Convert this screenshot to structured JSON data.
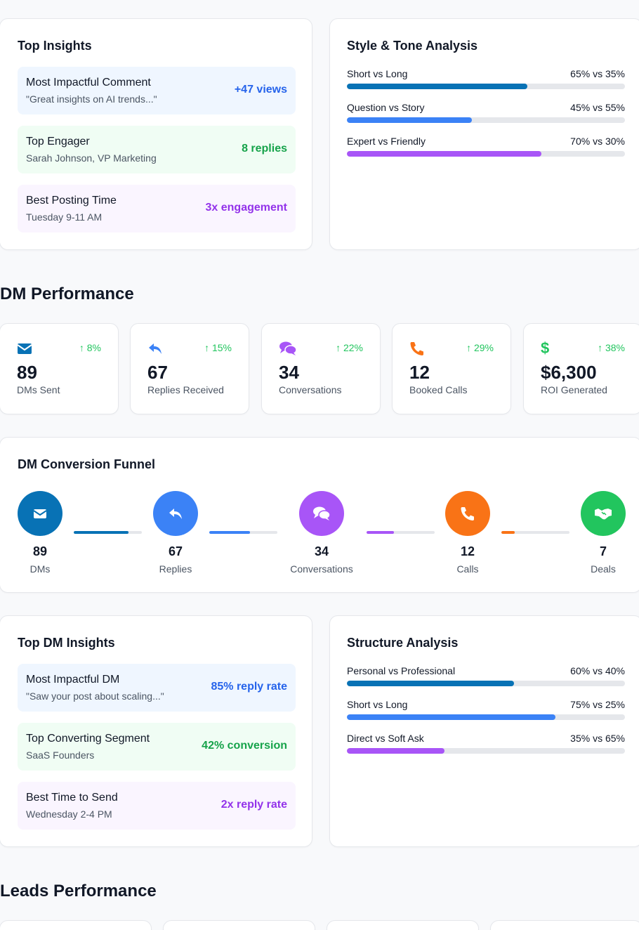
{
  "top_insights": {
    "title": "Top Insights",
    "items": [
      {
        "title": "Most Impactful Comment",
        "sub": "\"Great insights on AI trends...\"",
        "metric": "+47 views"
      },
      {
        "title": "Top Engager",
        "sub": "Sarah Johnson, VP Marketing",
        "metric": "8 replies"
      },
      {
        "title": "Best Posting Time",
        "sub": "Tuesday 9-11 AM",
        "metric": "3x engagement"
      }
    ]
  },
  "style_tone": {
    "title": "Style & Tone Analysis",
    "rows": [
      {
        "label": "Short vs Long",
        "value": "65% vs 35%",
        "percent": 65,
        "color": "#0872b5"
      },
      {
        "label": "Question vs Story",
        "value": "45% vs 55%",
        "percent": 45,
        "color": "#3b82f6"
      },
      {
        "label": "Expert vs Friendly",
        "value": "70% vs 30%",
        "percent": 70,
        "color": "#a855f7"
      }
    ]
  },
  "dm_performance": {
    "title": "DM Performance",
    "stats": [
      {
        "icon": "envelope-icon",
        "change": "8%",
        "value": "89",
        "label": "DMs Sent",
        "color": "#0872b5"
      },
      {
        "icon": "reply-icon",
        "change": "15%",
        "value": "67",
        "label": "Replies Received",
        "color": "#3b82f6"
      },
      {
        "icon": "comments-icon",
        "change": "22%",
        "value": "34",
        "label": "Conversations",
        "color": "#a855f7"
      },
      {
        "icon": "phone-icon",
        "change": "29%",
        "value": "12",
        "label": "Booked Calls",
        "color": "#f97316"
      },
      {
        "icon": "dollar-icon",
        "change": "38%",
        "value": "$6,300",
        "label": "ROI Generated",
        "color": "#22c55e"
      }
    ]
  },
  "funnel": {
    "title": "DM Conversion Funnel",
    "steps": [
      {
        "icon": "envelope-icon",
        "value": "89",
        "label": "DMs",
        "color": "#0872b5"
      },
      {
        "icon": "reply-icon",
        "value": "67",
        "label": "Replies",
        "color": "#3b82f6"
      },
      {
        "icon": "comments-icon",
        "value": "34",
        "label": "Conversations",
        "color": "#a855f7"
      },
      {
        "icon": "phone-icon",
        "value": "12",
        "label": "Calls",
        "color": "#f97316"
      },
      {
        "icon": "handshake-icon",
        "value": "7",
        "label": "Deals",
        "color": "#22c55e"
      }
    ],
    "connectors": [
      {
        "percent": 80,
        "color": "#0872b5"
      },
      {
        "percent": 60,
        "color": "#3b82f6"
      },
      {
        "percent": 40,
        "color": "#a855f7"
      },
      {
        "percent": 20,
        "color": "#f97316"
      }
    ]
  },
  "top_dm_insights": {
    "title": "Top DM Insights",
    "items": [
      {
        "title": "Most Impactful DM",
        "sub": "\"Saw your post about scaling...\"",
        "metric": "85% reply rate"
      },
      {
        "title": "Top Converting Segment",
        "sub": "SaaS Founders",
        "metric": "42% conversion"
      },
      {
        "title": "Best Time to Send",
        "sub": "Wednesday 2-4 PM",
        "metric": "2x reply rate"
      }
    ]
  },
  "structure": {
    "title": "Structure Analysis",
    "rows": [
      {
        "label": "Personal vs Professional",
        "value": "60% vs 40%",
        "percent": 60,
        "color": "#0872b5"
      },
      {
        "label": "Short vs Long",
        "value": "75% vs 25%",
        "percent": 75,
        "color": "#3b82f6"
      },
      {
        "label": "Direct vs Soft Ask",
        "value": "35% vs 65%",
        "percent": 35,
        "color": "#a855f7"
      }
    ]
  },
  "leads_performance": {
    "title": "Leads Performance"
  }
}
